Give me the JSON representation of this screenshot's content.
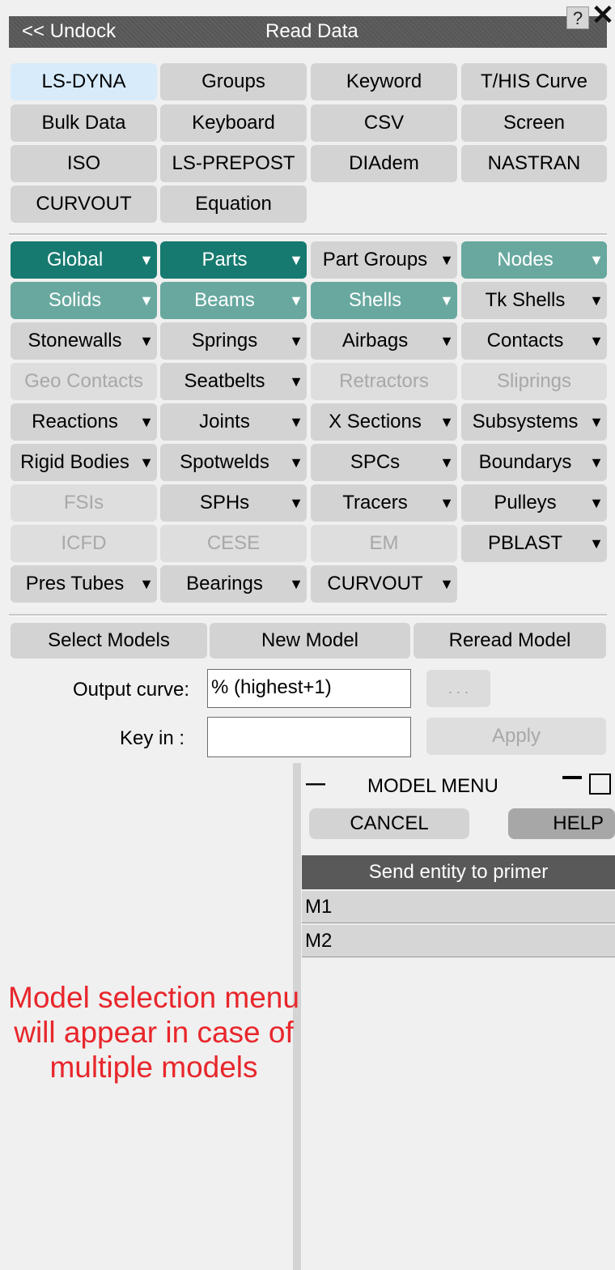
{
  "header": {
    "undock": "<< Undock",
    "title": "Read Data",
    "help_glyph": "?",
    "close_glyph": "✕"
  },
  "source_buttons": [
    "LS-DYNA",
    "Groups",
    "Keyword",
    "T/HIS Curve",
    "Bulk Data",
    "Keyboard",
    "CSV",
    "Screen",
    "ISO",
    "LS-PREPOST",
    "DIAdem",
    "NASTRAN",
    "CURVOUT",
    "Equation"
  ],
  "entity_buttons": [
    {
      "label": "Global",
      "state": "dark"
    },
    {
      "label": "Parts",
      "state": "dark"
    },
    {
      "label": "Part Groups",
      "state": "normal"
    },
    {
      "label": "Nodes",
      "state": "med"
    },
    {
      "label": "Solids",
      "state": "med"
    },
    {
      "label": "Beams",
      "state": "med"
    },
    {
      "label": "Shells",
      "state": "med"
    },
    {
      "label": "Tk Shells",
      "state": "normal"
    },
    {
      "label": "Stonewalls",
      "state": "normal"
    },
    {
      "label": "Springs",
      "state": "normal"
    },
    {
      "label": "Airbags",
      "state": "normal"
    },
    {
      "label": "Contacts",
      "state": "normal"
    },
    {
      "label": "Geo Contacts",
      "state": "disabled"
    },
    {
      "label": "Seatbelts",
      "state": "normal"
    },
    {
      "label": "Retractors",
      "state": "disabled"
    },
    {
      "label": "Sliprings",
      "state": "disabled"
    },
    {
      "label": "Reactions",
      "state": "normal"
    },
    {
      "label": "Joints",
      "state": "normal"
    },
    {
      "label": "X Sections",
      "state": "normal"
    },
    {
      "label": "Subsystems",
      "state": "normal"
    },
    {
      "label": "Rigid Bodies",
      "state": "normal"
    },
    {
      "label": "Spotwelds",
      "state": "normal"
    },
    {
      "label": "SPCs",
      "state": "normal"
    },
    {
      "label": "Boundarys",
      "state": "normal"
    },
    {
      "label": "FSIs",
      "state": "disabled"
    },
    {
      "label": "SPHs",
      "state": "normal"
    },
    {
      "label": "Tracers",
      "state": "normal"
    },
    {
      "label": "Pulleys",
      "state": "normal"
    },
    {
      "label": "ICFD",
      "state": "disabled"
    },
    {
      "label": "CESE",
      "state": "disabled"
    },
    {
      "label": "EM",
      "state": "disabled"
    },
    {
      "label": "PBLAST",
      "state": "normal"
    },
    {
      "label": "Pres Tubes",
      "state": "normal"
    },
    {
      "label": "Bearings",
      "state": "normal"
    },
    {
      "label": "CURVOUT",
      "state": "normal"
    }
  ],
  "arrow_glyph": "▼",
  "model_buttons": {
    "select": "Select Models",
    "new": "New Model",
    "reread": "Reread Model"
  },
  "output_curve": {
    "label": "Output curve:",
    "value": "% (highest+1)",
    "browse": ". . ."
  },
  "key_in": {
    "label": "Key in :",
    "value": "",
    "apply": "Apply"
  },
  "model_menu": {
    "minimize_glyph": "—",
    "title": "MODEL MENU",
    "cancel": "CANCEL",
    "help": "HELP",
    "header": "Send entity to primer",
    "models": [
      "M1",
      "M2"
    ]
  },
  "annotation": "Model selection menu will appear in case of multiple models",
  "colors": {
    "title_bar": "#595959",
    "dark_teal": "#177a70",
    "medium_teal": "#68a89f",
    "selected_source": "#d7ebfb",
    "annotation": "#e8262b"
  }
}
